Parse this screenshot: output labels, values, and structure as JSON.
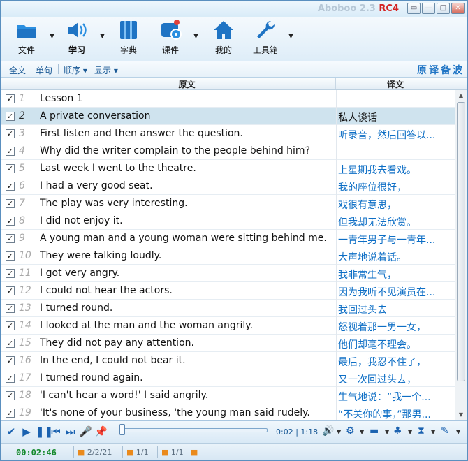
{
  "window": {
    "title": "Aboboo 2.3",
    "tag": "RC4",
    "buttons": [
      "▭",
      "—",
      "□",
      "✕"
    ]
  },
  "toolbar": [
    {
      "label": "文件",
      "icon": "folder-icon",
      "bold": false
    },
    {
      "label": "学习",
      "icon": "speaker-icon",
      "bold": true
    },
    {
      "label": "字典",
      "icon": "book-icon",
      "bold": false
    },
    {
      "label": "课件",
      "icon": "disc-icon",
      "bold": false
    },
    {
      "label": "我的",
      "icon": "home-icon",
      "bold": false
    },
    {
      "label": "工具箱",
      "icon": "wrench-icon",
      "bold": false
    }
  ],
  "subbar": {
    "items": [
      "全文",
      "单句",
      "顺序 ▾",
      "显示 ▾"
    ],
    "brand": "原译备波"
  },
  "columns": {
    "source": "原文",
    "translation": "译文"
  },
  "rows": [
    {
      "n": "1",
      "src": "Lesson 1",
      "tr": ""
    },
    {
      "n": "2",
      "src": "A private conversation",
      "tr": "私人谈话"
    },
    {
      "n": "3",
      "src": "First listen and then answer the question.",
      "tr": "听录音，然后回答以..."
    },
    {
      "n": "4",
      "src": "Why did the writer complain to the people behind him?",
      "tr": ""
    },
    {
      "n": "5",
      "src": "Last week I went to the theatre.",
      "tr": "上星期我去看戏。"
    },
    {
      "n": "6",
      "src": "I had a very good seat.",
      "tr": "我的座位很好，"
    },
    {
      "n": "7",
      "src": "The play was very interesting.",
      "tr": "戏很有意思，"
    },
    {
      "n": "8",
      "src": "I did not enjoy it.",
      "tr": "但我却无法欣赏。"
    },
    {
      "n": "9",
      "src": "A young man and a young woman were sitting behind me.",
      "tr": "一青年男子与一青年..."
    },
    {
      "n": "10",
      "src": "They were talking loudly.",
      "tr": "大声地说着话。"
    },
    {
      "n": "11",
      "src": "I got very angry.",
      "tr": "我非常生气，"
    },
    {
      "n": "12",
      "src": "I could not hear the actors.",
      "tr": "因为我听不见演员在..."
    },
    {
      "n": "13",
      "src": "I turned round.",
      "tr": "我回过头去"
    },
    {
      "n": "14",
      "src": "I looked at the man and the woman angrily.",
      "tr": "怒视着那一男一女，"
    },
    {
      "n": "15",
      "src": "They did not pay any attention.",
      "tr": "他们却毫不理会。"
    },
    {
      "n": "16",
      "src": "In the end, I could not bear it.",
      "tr": "最后，我忍不住了，"
    },
    {
      "n": "17",
      "src": "I turned round again.",
      "tr": "又一次回过头去，"
    },
    {
      "n": "18",
      "src": "'I can't hear a word!' I said angrily.",
      "tr": "生气地说：“我一个..."
    },
    {
      "n": "19",
      "src": "'It's none of your business, 'the young man said rudely.",
      "tr": "“不关你的事，”那男..."
    }
  ],
  "selected_row": 2,
  "player": {
    "time": "0:02 | 1:18",
    "progress": 0.0
  },
  "status": {
    "elapsed": "00:02:46",
    "cells": [
      "2/2/21",
      "1/1",
      "1/1",
      ""
    ]
  },
  "colors": {
    "accent": "#1f74c4",
    "selected": "#cfe3ee",
    "translation": "#0d6ec5",
    "elapsed": "#168a2d"
  }
}
